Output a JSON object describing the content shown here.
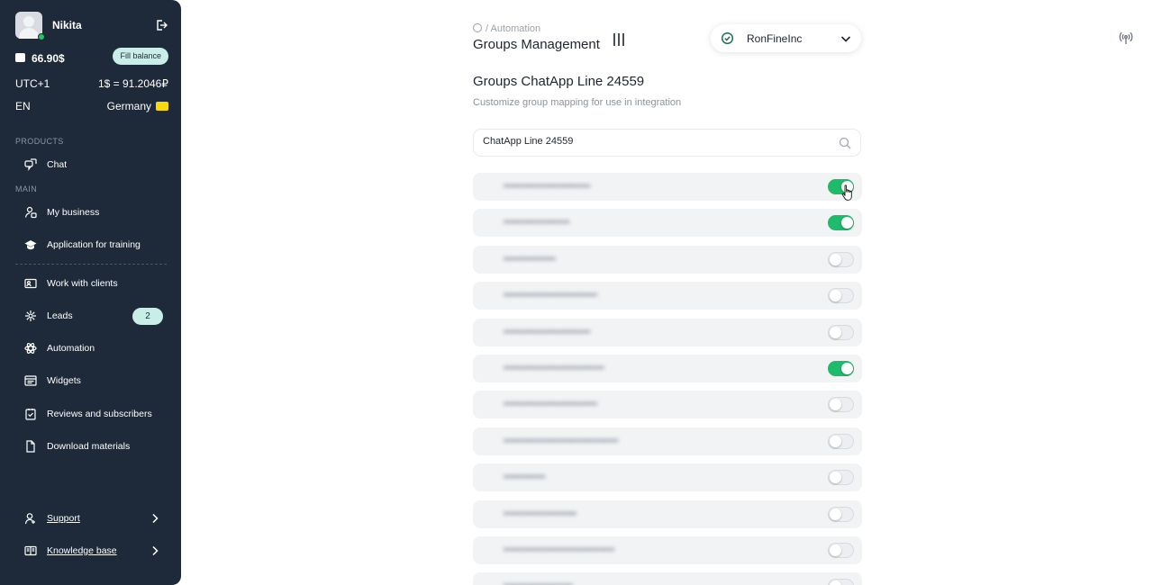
{
  "profile": {
    "name": "Nikita"
  },
  "account": {
    "balance": "66.90$",
    "fill_balance": "Fill balance",
    "timezone": "UTC+1",
    "rate": "1$ = 91.2046₽",
    "language": "EN",
    "country": "Germany"
  },
  "sidebar": {
    "products_label": "PRODUCTS",
    "main_label": "MAIN",
    "chat": "Chat",
    "my_business": "My business",
    "training": "Application for training",
    "work_clients": "Work with clients",
    "leads": "Leads",
    "leads_count": "2",
    "automation": "Automation",
    "widgets": "Widgets",
    "reviews": "Reviews and subscribers",
    "download": "Download materials",
    "support": "Support",
    "knowledge": "Knowledge base"
  },
  "header": {
    "breadcrumb": "/ Automation",
    "title": "Groups Management",
    "company": "RonFineInc"
  },
  "content": {
    "title": "Groups ChatApp Line 24559",
    "subtitle": "Customize group mapping for use in integration",
    "search_value": "ChatApp Line 24559"
  },
  "groups": [
    {
      "label": "•••••••••••••••••••••••••",
      "enabled": true
    },
    {
      "label": "•••••••••••••••••••",
      "enabled": true
    },
    {
      "label": "•••••••••••••••",
      "enabled": false
    },
    {
      "label": "•••••••••••••••••••••••••••",
      "enabled": false
    },
    {
      "label": "•••••••••••••••••••••••••",
      "enabled": false
    },
    {
      "label": "•••••••••••••••••••••••••••••",
      "enabled": true
    },
    {
      "label": "•••••••••••••••••••••••••••",
      "enabled": false
    },
    {
      "label": "•••••••••••••••••••••••••••••••••",
      "enabled": false
    },
    {
      "label": "••••••••••••",
      "enabled": false
    },
    {
      "label": "•••••••••••••••••••••",
      "enabled": false
    },
    {
      "label": "••••••••••••••••••••••••••••••••",
      "enabled": false
    },
    {
      "label": "••••••••••••••••••••",
      "enabled": false
    }
  ],
  "colors": {
    "sidebar": "#1e2a3a",
    "accent": "#1dbb6a",
    "badge": "#c9ede7"
  }
}
